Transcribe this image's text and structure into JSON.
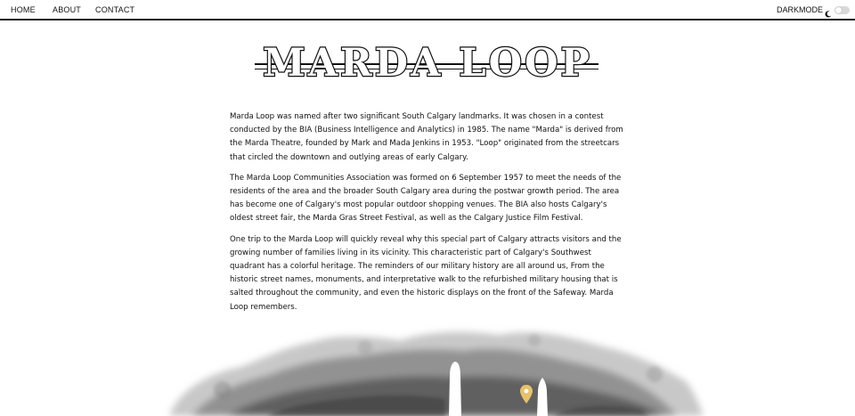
{
  "nav": {
    "home": "HOME",
    "about": "ABOUT",
    "contact": "CONTACT"
  },
  "darkmode": {
    "label": "DARKMODE",
    "icon": "moon-icon",
    "enabled": false
  },
  "page": {
    "title": "MARDA LOOP",
    "paragraphs": [
      "Marda Loop was named after two significant South Calgary landmarks. It was chosen in a contest conducted by the BIA (Business Intelligence and Analytics) in 1985. The name \"Marda\" is derived from the Marda Theatre, founded by Mark and Mada Jenkins in 1953. \"Loop\" originated from the streetcars that circled the downtown and outlying areas of early Calgary.",
      "The Marda Loop Communities Association was formed on 6 September 1957 to meet the needs of the residents of the area and the broader South Calgary area during the postwar growth period. The area has become one of Calgary's most popular outdoor shopping venues. The BIA also hosts Calgary's oldest street fair, the Marda Gras Street Festival, as well as the Calgary Justice Film Festival.",
      "One trip to the Marda Loop will quickly reveal why this special part of Calgary attracts visitors and the growing number of families living in its vicinity. This characteristic part of Calgary's Southwest quadrant has a colorful heritage. The reminders of our military history are all around us, From the historic street names, monuments, and interpretative walk to the refurbished military housing that is salted throughout the community, and even the historic displays on the front of the Safeway. Marda Loop remembers."
    ]
  },
  "colors": {
    "text": "#111111",
    "background": "#ffffff",
    "pin": "#e8c26a",
    "ink": "#3a3a3a"
  }
}
